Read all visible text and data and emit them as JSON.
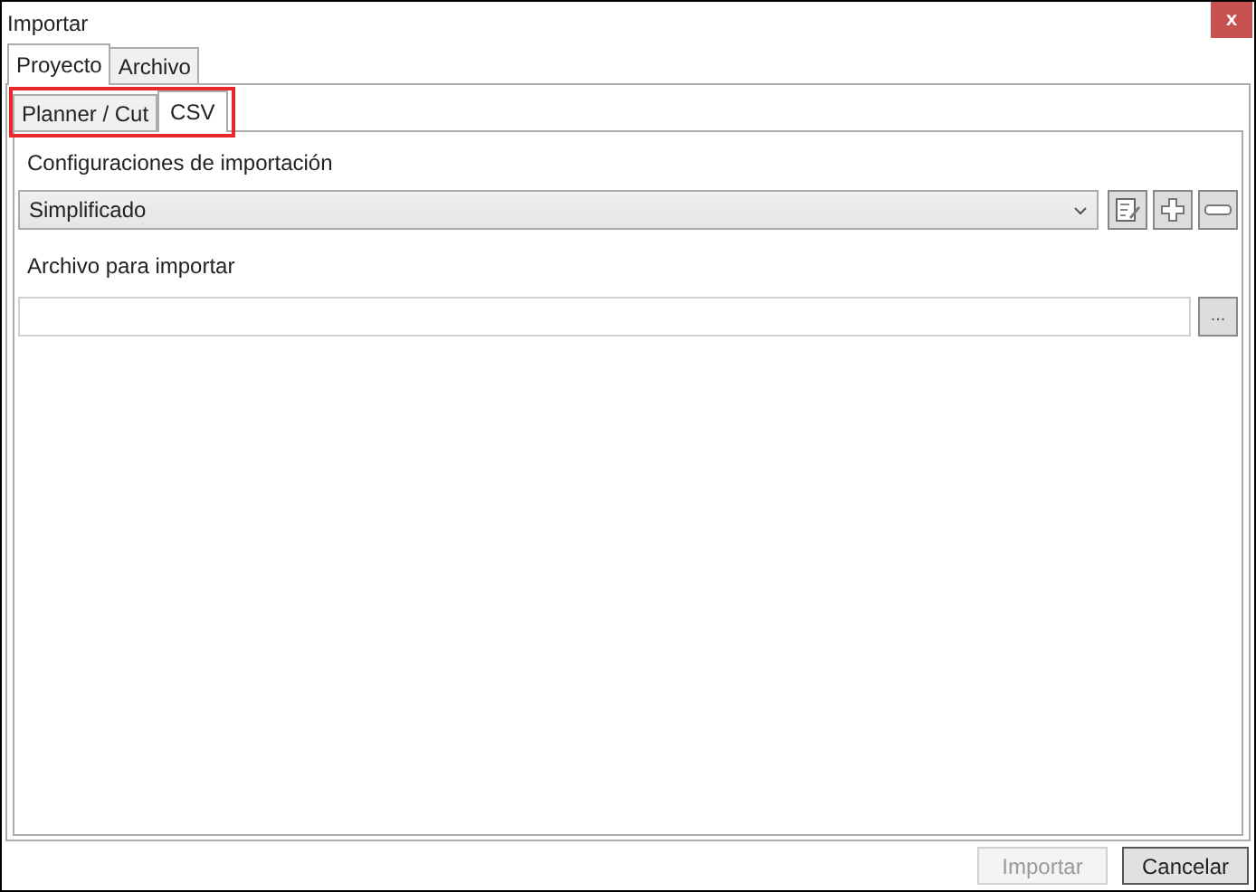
{
  "window": {
    "title": "Importar",
    "close": "x"
  },
  "tabs": [
    {
      "label": "Proyecto",
      "selected": true
    },
    {
      "label": "Archivo",
      "selected": false
    }
  ],
  "subtabs": [
    {
      "label": "Planner / Cut",
      "selected": false
    },
    {
      "label": "CSV",
      "selected": true
    }
  ],
  "config": {
    "label": "Configuraciones de importación",
    "value": "Simplificado"
  },
  "file": {
    "label": "Archivo para importar",
    "browse": "..."
  },
  "buttons": [
    {
      "label": "Importar",
      "disabled": true
    },
    {
      "label": "Cancelar",
      "disabled": false
    }
  ]
}
